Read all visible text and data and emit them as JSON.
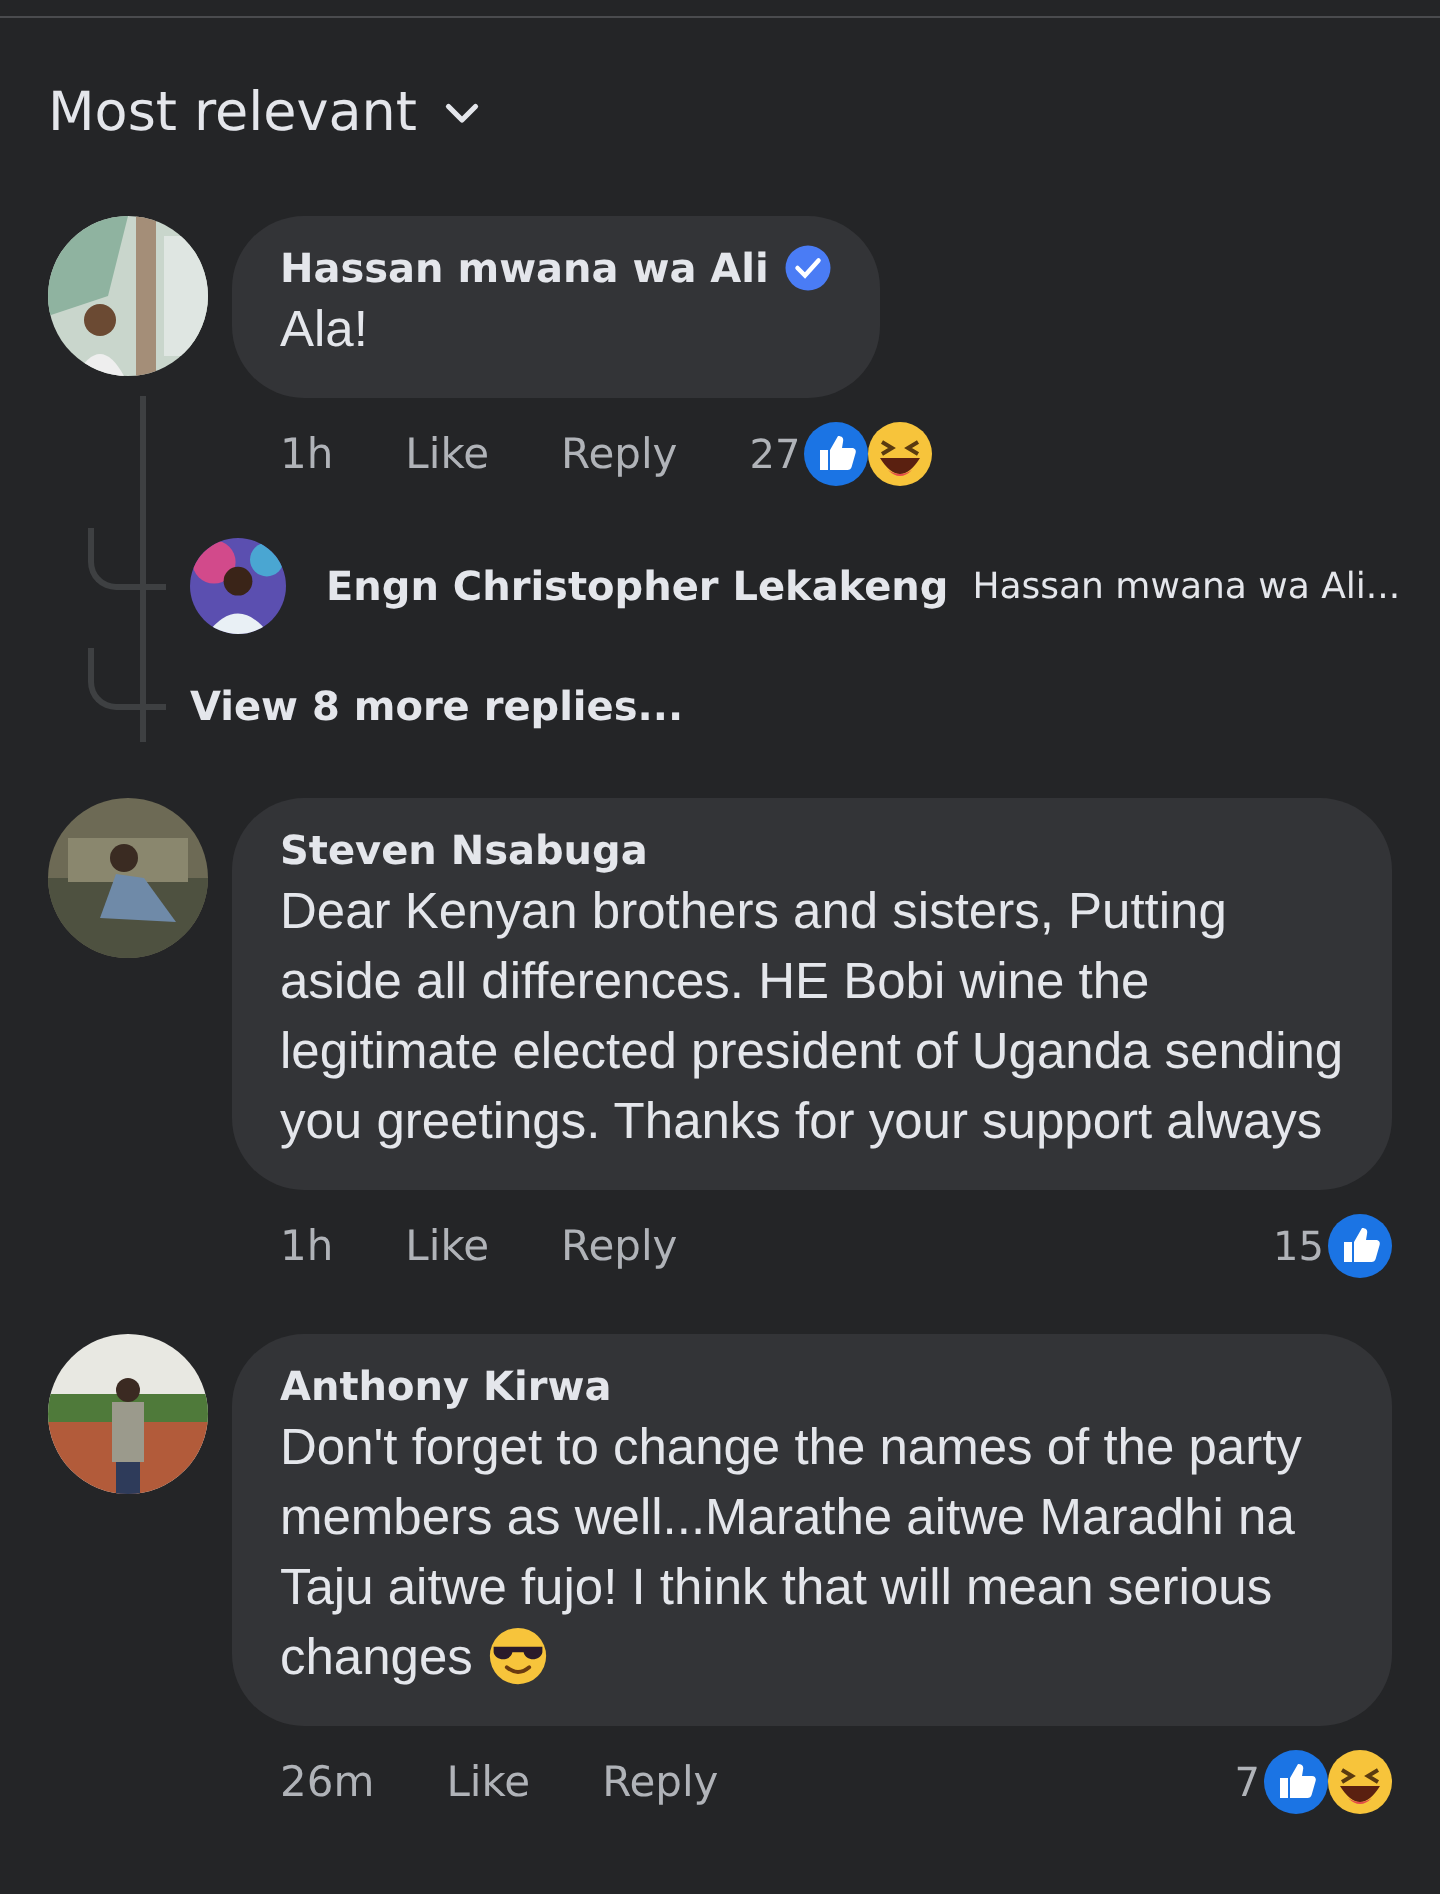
{
  "sort": {
    "label": "Most relevant"
  },
  "comments": [
    {
      "author": "Hassan mwana wa Ali",
      "verified": true,
      "text": "Ala!",
      "ends_with_emoji": false,
      "time": "1h",
      "like": "Like",
      "reply": "Reply",
      "reaction_count": "27",
      "reactions": [
        {
          "kind": "like"
        },
        {
          "kind": "haha"
        }
      ],
      "replies": [
        {
          "author": "Engn Christopher Lekakeng",
          "text": "Hassan mwana wa Ali..."
        }
      ],
      "more_replies": "View 8 more replies..."
    },
    {
      "author": "Steven Nsabuga",
      "verified": false,
      "text": "Dear Kenyan brothers and sisters, Putting aside all differences. HE Bobi wine the legitimate elected president of Uganda sending you greetings. Thanks for your support always",
      "ends_with_emoji": false,
      "time": "1h",
      "like": "Like",
      "reply": "Reply",
      "reaction_count": "15",
      "reactions": [
        {
          "kind": "like"
        }
      ]
    },
    {
      "author": "Anthony Kirwa",
      "verified": false,
      "text": "Don't forget to change the names of the party members as well...Marathe aitwe Maradhi na Taju aitwe fujo! I think that will mean serious changes",
      "ends_with_emoji": true,
      "time": "26m",
      "like": "Like",
      "reply": "Reply",
      "reaction_count": "7",
      "reactions": [
        {
          "kind": "like"
        },
        {
          "kind": "haha"
        }
      ]
    }
  ]
}
